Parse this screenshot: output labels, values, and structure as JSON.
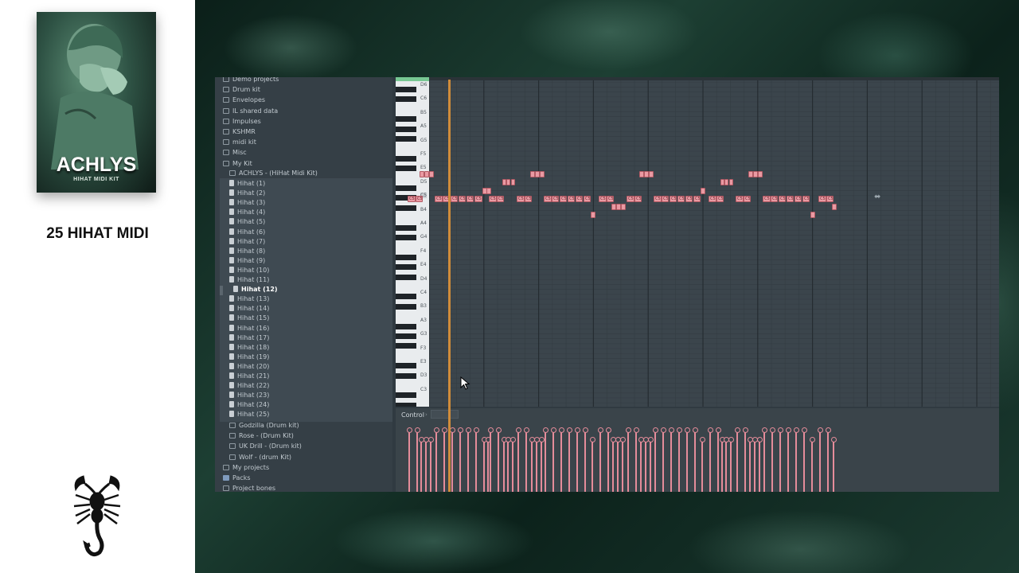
{
  "promo": {
    "cover_title": "ACHLYS",
    "cover_subtitle": "HIHAT MIDI KIT",
    "caption": "25 HIHAT MIDI"
  },
  "browser": {
    "top_folders": [
      "Demo projects",
      "Drum kit",
      "Envelopes",
      "IL shared data",
      "Impulses",
      "KSHMR",
      "midi kit",
      "Misc",
      "My Kit"
    ],
    "subfolder": "ACHLYS - (HiHat Midi Kit)",
    "hihat_files": [
      "Hihat (1)",
      "Hihat (2)",
      "Hihat (3)",
      "Hihat (4)",
      "Hihat (5)",
      "Hihat (6)",
      "Hihat (7)",
      "Hihat (8)",
      "Hihat (9)",
      "Hihat (10)",
      "Hihat (11)",
      "Hihat (12)",
      "Hihat (13)",
      "Hihat (14)",
      "Hihat (15)",
      "Hihat (16)",
      "Hihat (17)",
      "Hihat (18)",
      "Hihat (19)",
      "Hihat (20)",
      "Hihat (21)",
      "Hihat (22)",
      "Hihat (23)",
      "Hihat (24)",
      "Hihat (25)"
    ],
    "selected_index": 11,
    "other_kits": [
      "Godzilla (Drum kit)",
      "Rose - (Drum Kit)",
      "UK Drill - (Drum kit)",
      "Wolf - (drum Kit)"
    ],
    "bottom_items": [
      {
        "label": "My projects",
        "icon": "folder-icon"
      },
      {
        "label": "Packs",
        "icon": "pack-icon"
      },
      {
        "label": "Project bones",
        "icon": "folder-icon"
      }
    ]
  },
  "piano_roll": {
    "key_labels": [
      "D6",
      "C6",
      "B5",
      "A5",
      "G5",
      "F5",
      "E5",
      "D5",
      "C5",
      "B4",
      "A4",
      "G4",
      "F4",
      "E4",
      "D4",
      "C4",
      "B3",
      "A3",
      "G3",
      "F3",
      "E3",
      "D3",
      "C3"
    ],
    "note_label": "C5",
    "colors": {
      "note": "#e99aa3",
      "playhead": "#d08c3a",
      "keys_accent": "#78c893"
    }
  },
  "control": {
    "label": "Control",
    "arrow": "›"
  }
}
